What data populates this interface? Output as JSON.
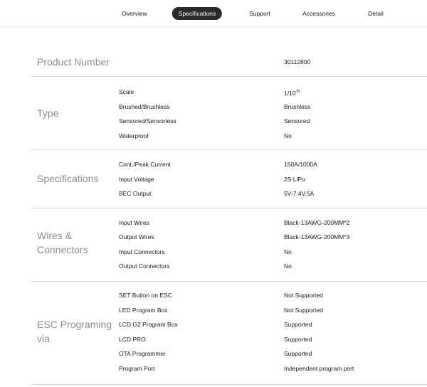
{
  "nav": {
    "tabs": [
      {
        "label": "Overview",
        "active": false
      },
      {
        "label": "Specifications",
        "active": true
      },
      {
        "label": "Support",
        "active": false
      },
      {
        "label": "Accessories",
        "active": false
      },
      {
        "label": "Detail",
        "active": false
      }
    ]
  },
  "product_number": {
    "label": "Product Number",
    "value": "30112800"
  },
  "sections": [
    {
      "title_lines": [
        "Type"
      ],
      "rows": [
        {
          "label": "Scale",
          "value": "1/10",
          "sup": "th"
        },
        {
          "label": "Brushed/Brushless",
          "value": "Brushless"
        },
        {
          "label": "Sensored/Sensorless",
          "value": "Sensored"
        },
        {
          "label": "Waterproof",
          "value": "No"
        }
      ]
    },
    {
      "title_lines": [
        "Specifications"
      ],
      "rows": [
        {
          "label": "Cont./Peak Current",
          "value": "150A/1000A"
        },
        {
          "label": "Input Voltage",
          "value": "2S LiPo"
        },
        {
          "label": "BEC Output",
          "value": "5V-7.4V,5A"
        }
      ]
    },
    {
      "title_lines": [
        "Wires &",
        "Connectors"
      ],
      "rows": [
        {
          "label": "Input Wires",
          "value": "Black-13AWG-200MM*2"
        },
        {
          "label": "Output Wires",
          "value": "Black-13AWG-200MM*3"
        },
        {
          "label": "Input Connectors",
          "value": "No"
        },
        {
          "label": "Output Connectors",
          "value": "No"
        }
      ]
    },
    {
      "title_lines": [
        "ESC Programing",
        "via"
      ],
      "rows": [
        {
          "label": "SET Button on ESC",
          "value": "Not Supported"
        },
        {
          "label": "LED Program Box",
          "value": "Not Supported"
        },
        {
          "label": "LCD G2 Program Box",
          "value": "Supported"
        },
        {
          "label": "LCD PRO",
          "value": "Supported"
        },
        {
          "label": "OTA Programmer",
          "value": "Supported"
        },
        {
          "label": "Program Port",
          "value": "Independent program port"
        }
      ]
    }
  ]
}
